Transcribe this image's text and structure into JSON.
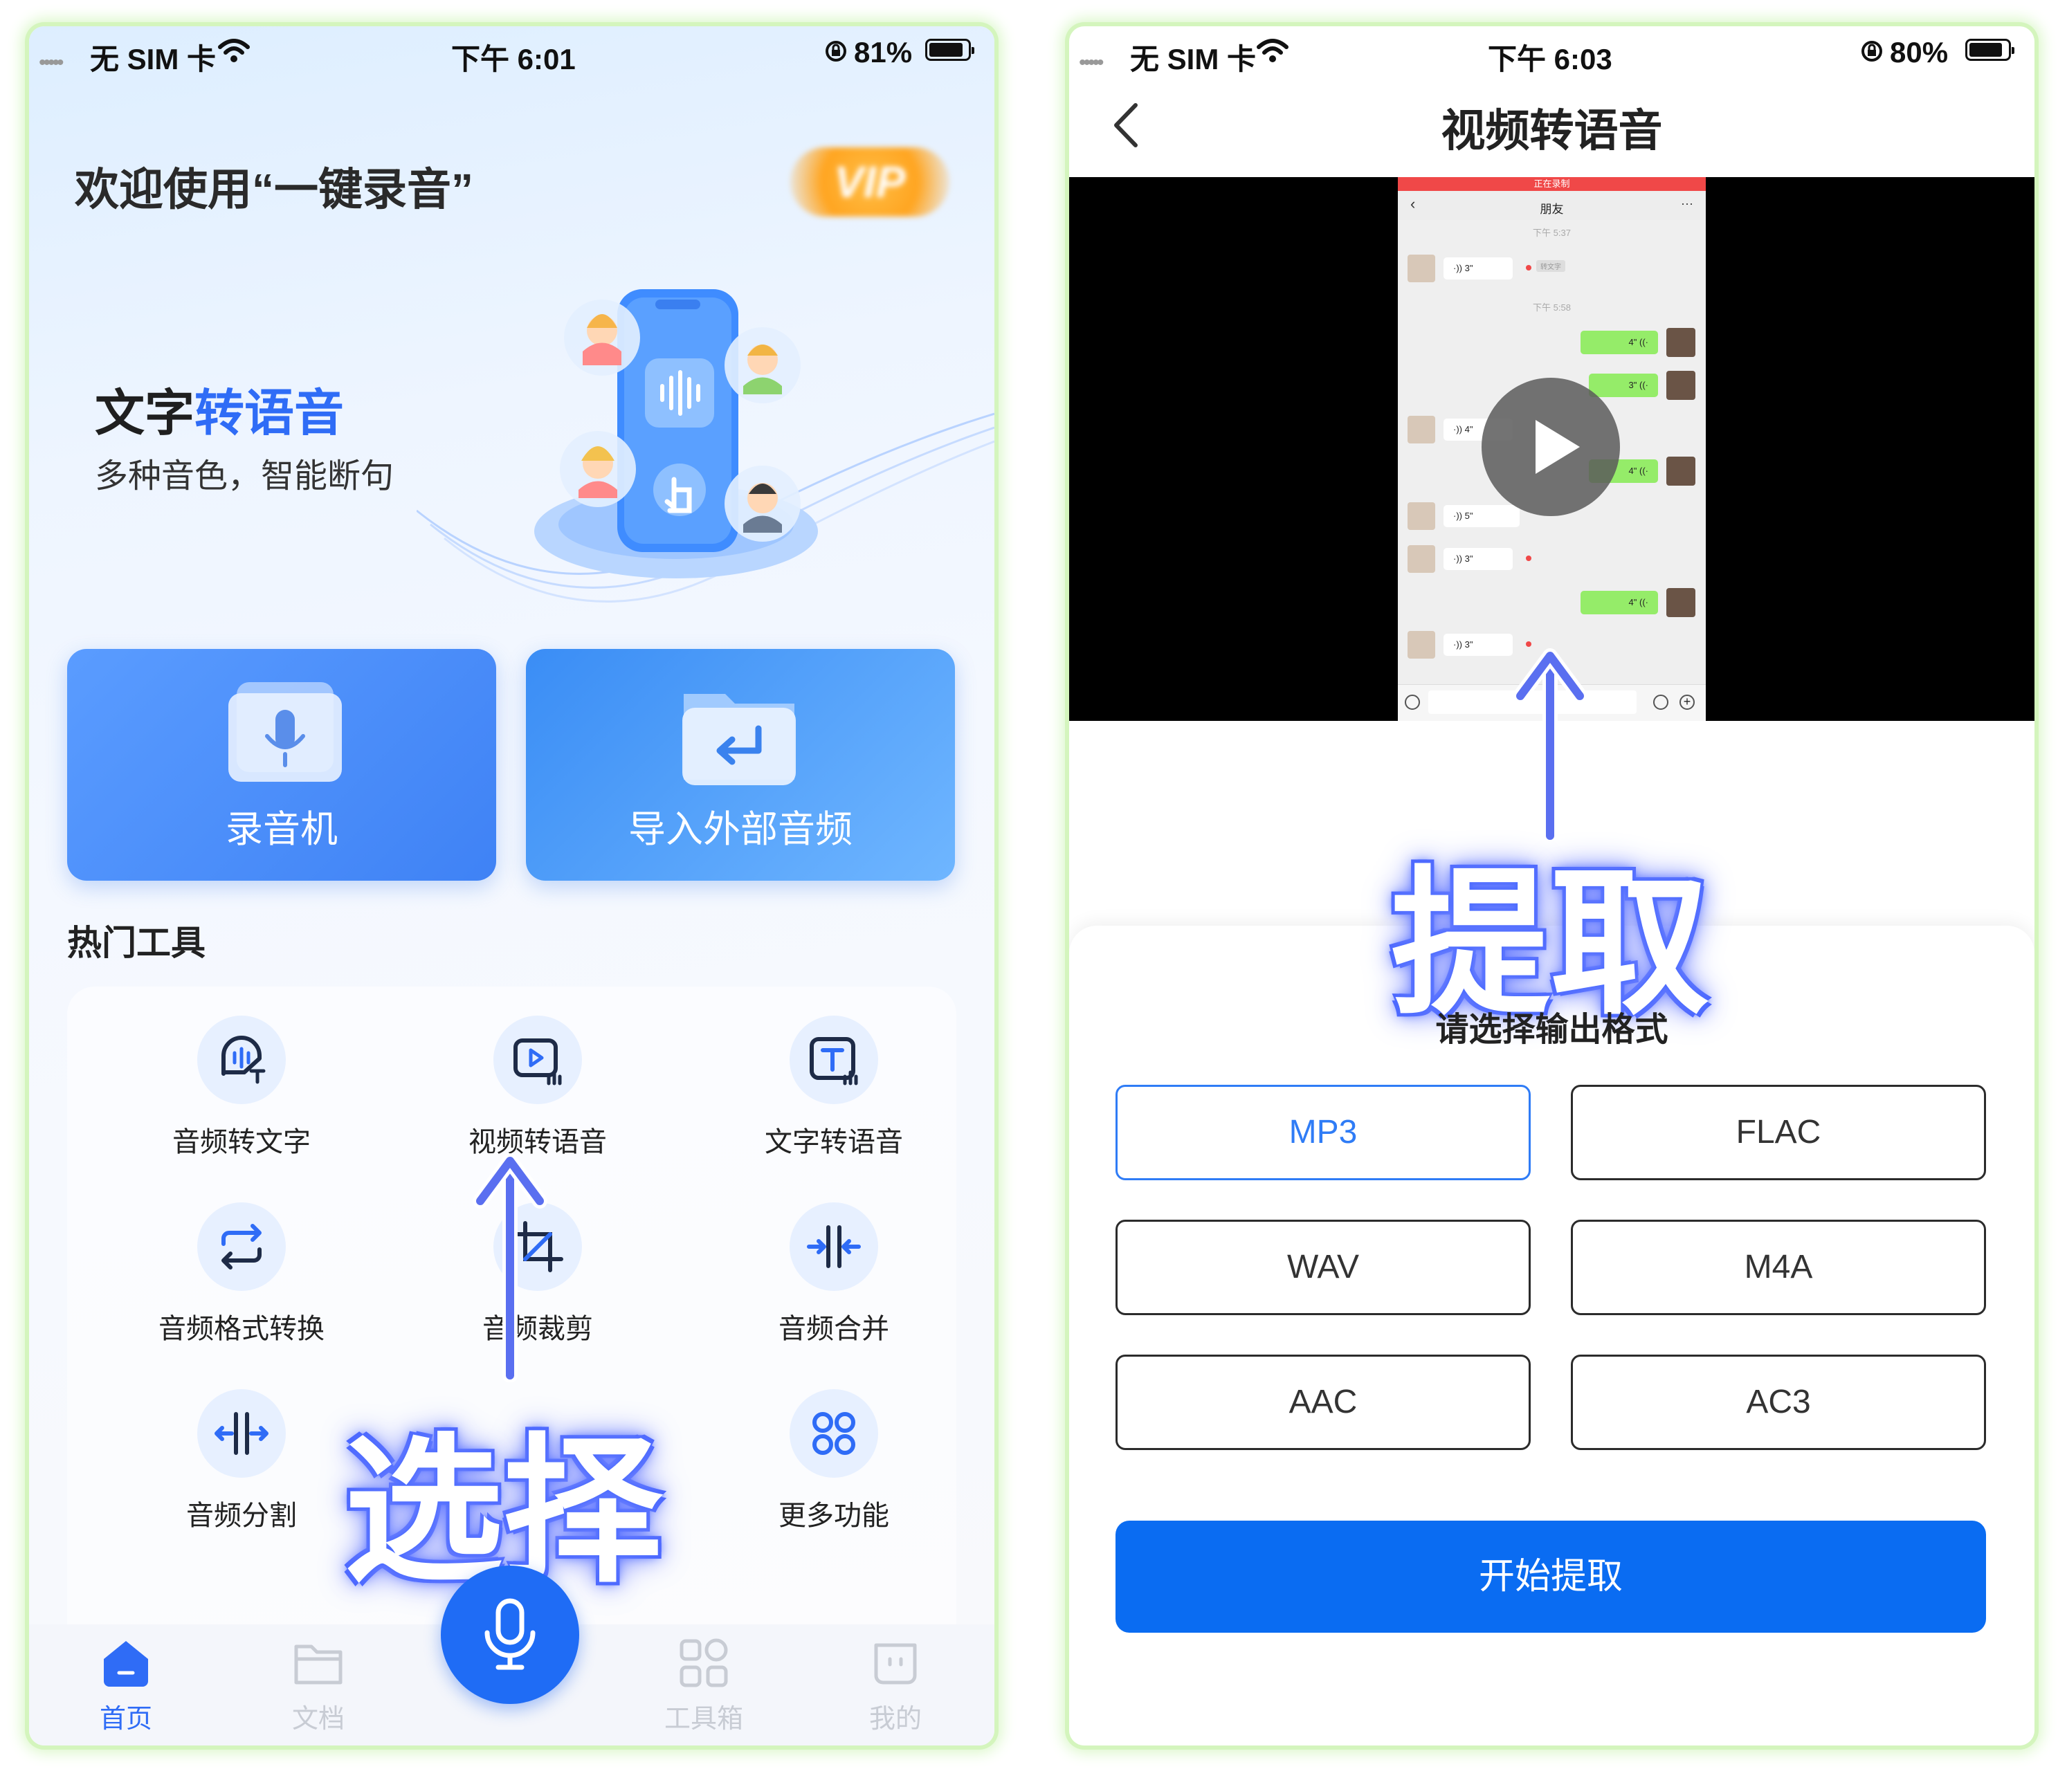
{
  "left_screen": {
    "status_bar": {
      "carrier": "无 SIM 卡",
      "time": "下午 6:01",
      "battery": "81%",
      "battery_level": 0.81
    },
    "header": {
      "welcome": "欢迎使用“一键录音”",
      "vip_badge": "VIP"
    },
    "banner": {
      "title_part1": "文字",
      "title_part2": "转语音",
      "subtitle": "多种音色，智能断句"
    },
    "main_cards": [
      {
        "label": "录音机",
        "icon": "microphone-folder-icon"
      },
      {
        "label": "导入外部音频",
        "icon": "import-folder-icon"
      }
    ],
    "hot_tools": {
      "title": "热门工具",
      "items": [
        {
          "label": "音频转文字",
          "icon": "audio-to-text-icon"
        },
        {
          "label": "视频转语音",
          "icon": "video-to-audio-icon"
        },
        {
          "label": "文字转语音",
          "icon": "text-to-speech-icon"
        },
        {
          "label": "音频格式转换",
          "icon": "format-convert-icon"
        },
        {
          "label": "音频裁剪",
          "icon": "crop-icon"
        },
        {
          "label": "音频合并",
          "icon": "merge-icon"
        },
        {
          "label": "音频分割",
          "icon": "split-icon"
        },
        {
          "label": "更多功能",
          "icon": "more-icon"
        }
      ]
    },
    "tabbar": {
      "items": [
        {
          "label": "首页",
          "icon": "home-icon",
          "active": true
        },
        {
          "label": "文档",
          "icon": "folder-icon",
          "active": false
        },
        {
          "label": "工具箱",
          "icon": "toolbox-icon",
          "active": false
        },
        {
          "label": "我的",
          "icon": "profile-icon",
          "active": false
        }
      ],
      "center_button": "microphone-icon"
    },
    "overlay_text": "选择"
  },
  "right_screen": {
    "status_bar": {
      "carrier": "无 SIM 卡",
      "time": "下午 6:03",
      "battery": "80%",
      "battery_level": 0.8
    },
    "nav": {
      "title": "视频转语音",
      "back_icon": "chevron-left-icon"
    },
    "video": {
      "recording_banner": "正在录制",
      "chat_title": "朋友",
      "chat_time1": "下午 5:37",
      "chat_time2": "下午 5:58",
      "to_text": "转文字",
      "messages": [
        {
          "side": "left",
          "duration": "3\""
        },
        {
          "side": "right",
          "duration": "4\""
        },
        {
          "side": "right",
          "duration": "3\""
        },
        {
          "side": "left",
          "duration": "4\""
        },
        {
          "side": "right",
          "duration": "4\""
        },
        {
          "side": "left",
          "duration": "5\""
        },
        {
          "side": "left",
          "duration": "3\""
        },
        {
          "side": "right",
          "duration": "4\""
        },
        {
          "side": "left",
          "duration": "3\""
        }
      ],
      "play_icon": "play-icon"
    },
    "overlay_text": "提取",
    "format_prompt": "请选择输出格式",
    "formats": [
      "MP3",
      "FLAC",
      "WAV",
      "M4A",
      "AAC",
      "AC3"
    ],
    "selected_format": "MP3",
    "start_button": "开始提取"
  }
}
